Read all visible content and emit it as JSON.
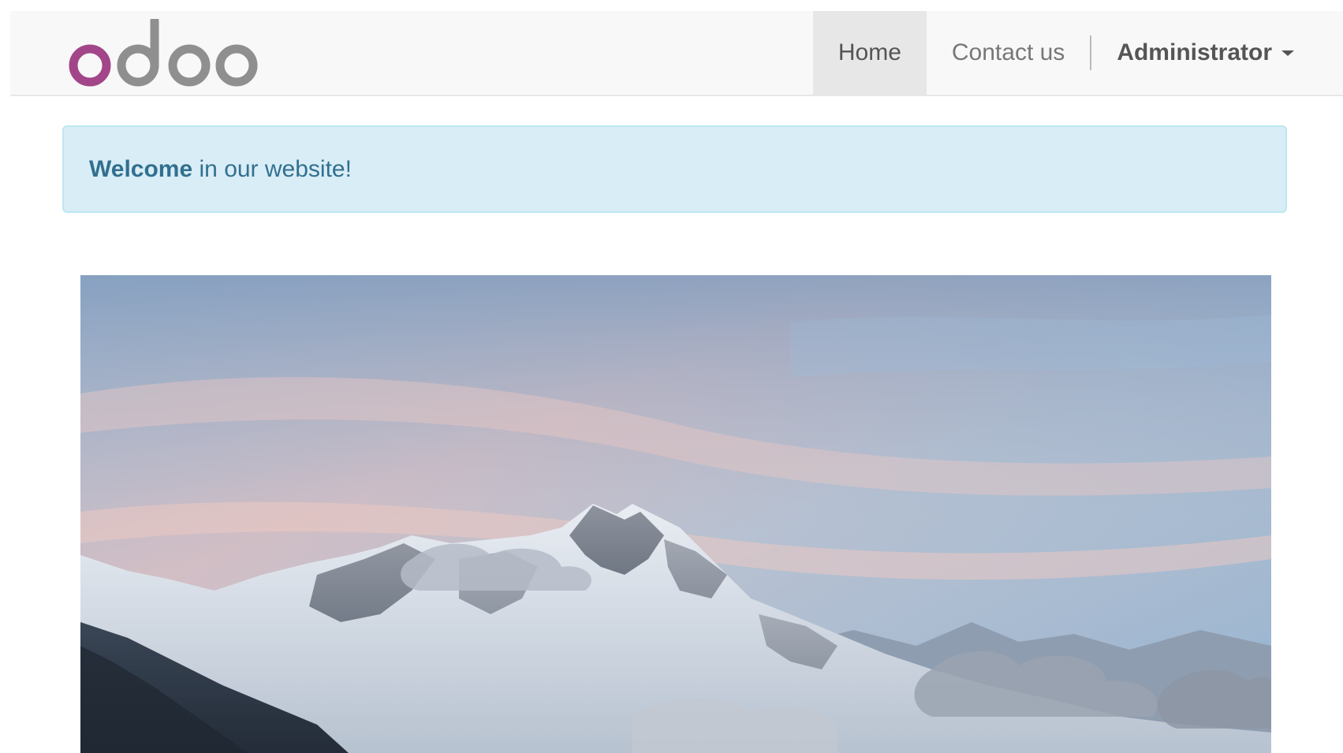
{
  "navbar": {
    "brand_name": "odoo",
    "brand_colors": {
      "first_letter": "#a24689",
      "rest": "#8f8f8f"
    },
    "items": [
      {
        "label": "Home",
        "active": true
      },
      {
        "label": "Contact us",
        "active": false
      }
    ],
    "user_menu": {
      "label": "Administrator",
      "icon": "caret-down-icon"
    }
  },
  "alert": {
    "strong_text": "Welcome",
    "text": " in our website!",
    "colors": {
      "background": "#d9edf7",
      "border": "#bce8f1",
      "text": "#31708f"
    }
  },
  "hero": {
    "subject": "snow-capped mountain at dusk"
  }
}
